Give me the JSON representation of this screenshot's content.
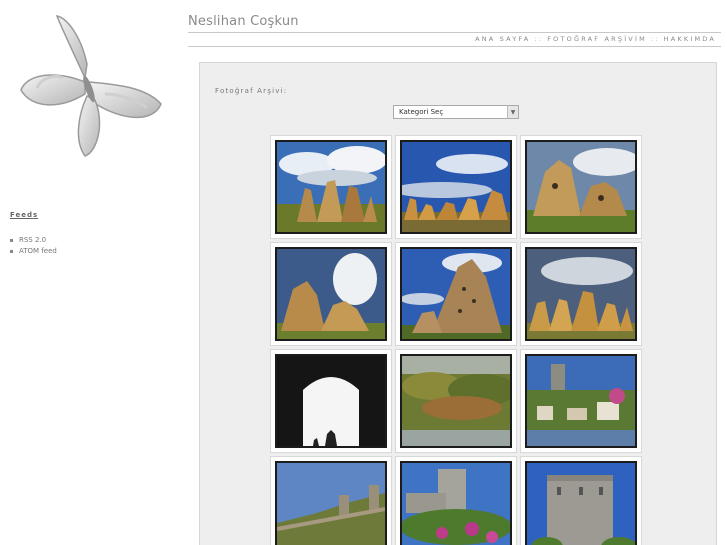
{
  "site": {
    "title": "Neslihan Coşkun"
  },
  "nav": {
    "items": [
      "ANA SAYFA",
      "FOTOĞRAF ARŞİVİM",
      "HAKKIMDA"
    ],
    "separator": "::"
  },
  "sidebar": {
    "feeds_title": "Feeds",
    "feeds": [
      "RSS 2.0",
      "ATOM feed"
    ]
  },
  "main": {
    "archive_title": "Fotoğraf Arşivi:",
    "category_select": {
      "selected": "Kategori Seç"
    }
  },
  "gallery": [
    {
      "scene": "cappadocia-fairy-chimneys"
    },
    {
      "scene": "cappadocia-rock-row-blue-sky"
    },
    {
      "scene": "cappadocia-rock-house"
    },
    {
      "scene": "cappadocia-rock-cloud"
    },
    {
      "scene": "uchisar-castle"
    },
    {
      "scene": "cappadocia-rock-ridge"
    },
    {
      "scene": "dark-archway"
    },
    {
      "scene": "bosphorus-forest-shore"
    },
    {
      "scene": "bosphorus-village-tower"
    },
    {
      "scene": "fortress-walls-hillside"
    },
    {
      "scene": "rumeli-tower-flowers"
    },
    {
      "scene": "rumeli-round-tower"
    }
  ],
  "colors": {
    "accent_text": "#888888",
    "panel_bg": "#eeeeee"
  }
}
